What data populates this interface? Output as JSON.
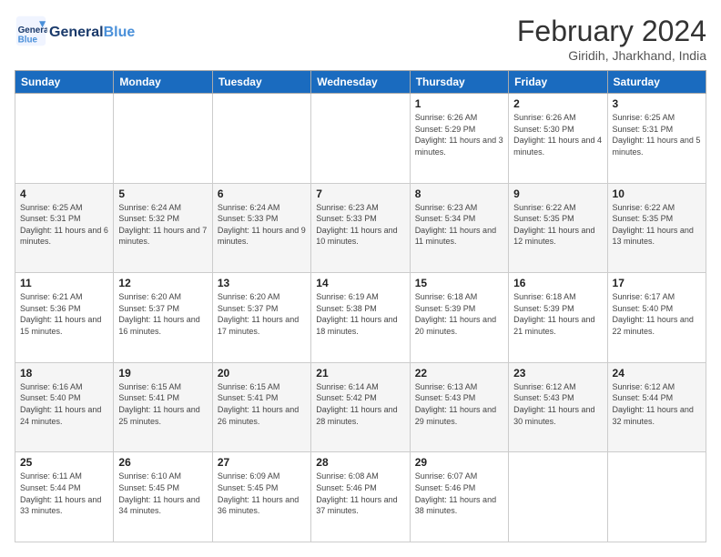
{
  "header": {
    "logo": {
      "general": "General",
      "blue": "Blue"
    },
    "title": "February 2024",
    "location": "Giridih, Jharkhand, India"
  },
  "weekdays": [
    "Sunday",
    "Monday",
    "Tuesday",
    "Wednesday",
    "Thursday",
    "Friday",
    "Saturday"
  ],
  "weeks": [
    [
      {
        "day": "",
        "info": ""
      },
      {
        "day": "",
        "info": ""
      },
      {
        "day": "",
        "info": ""
      },
      {
        "day": "",
        "info": ""
      },
      {
        "day": "1",
        "info": "Sunrise: 6:26 AM\nSunset: 5:29 PM\nDaylight: 11 hours and 3 minutes."
      },
      {
        "day": "2",
        "info": "Sunrise: 6:26 AM\nSunset: 5:30 PM\nDaylight: 11 hours and 4 minutes."
      },
      {
        "day": "3",
        "info": "Sunrise: 6:25 AM\nSunset: 5:31 PM\nDaylight: 11 hours and 5 minutes."
      }
    ],
    [
      {
        "day": "4",
        "info": "Sunrise: 6:25 AM\nSunset: 5:31 PM\nDaylight: 11 hours and 6 minutes."
      },
      {
        "day": "5",
        "info": "Sunrise: 6:24 AM\nSunset: 5:32 PM\nDaylight: 11 hours and 7 minutes."
      },
      {
        "day": "6",
        "info": "Sunrise: 6:24 AM\nSunset: 5:33 PM\nDaylight: 11 hours and 9 minutes."
      },
      {
        "day": "7",
        "info": "Sunrise: 6:23 AM\nSunset: 5:33 PM\nDaylight: 11 hours and 10 minutes."
      },
      {
        "day": "8",
        "info": "Sunrise: 6:23 AM\nSunset: 5:34 PM\nDaylight: 11 hours and 11 minutes."
      },
      {
        "day": "9",
        "info": "Sunrise: 6:22 AM\nSunset: 5:35 PM\nDaylight: 11 hours and 12 minutes."
      },
      {
        "day": "10",
        "info": "Sunrise: 6:22 AM\nSunset: 5:35 PM\nDaylight: 11 hours and 13 minutes."
      }
    ],
    [
      {
        "day": "11",
        "info": "Sunrise: 6:21 AM\nSunset: 5:36 PM\nDaylight: 11 hours and 15 minutes."
      },
      {
        "day": "12",
        "info": "Sunrise: 6:20 AM\nSunset: 5:37 PM\nDaylight: 11 hours and 16 minutes."
      },
      {
        "day": "13",
        "info": "Sunrise: 6:20 AM\nSunset: 5:37 PM\nDaylight: 11 hours and 17 minutes."
      },
      {
        "day": "14",
        "info": "Sunrise: 6:19 AM\nSunset: 5:38 PM\nDaylight: 11 hours and 18 minutes."
      },
      {
        "day": "15",
        "info": "Sunrise: 6:18 AM\nSunset: 5:39 PM\nDaylight: 11 hours and 20 minutes."
      },
      {
        "day": "16",
        "info": "Sunrise: 6:18 AM\nSunset: 5:39 PM\nDaylight: 11 hours and 21 minutes."
      },
      {
        "day": "17",
        "info": "Sunrise: 6:17 AM\nSunset: 5:40 PM\nDaylight: 11 hours and 22 minutes."
      }
    ],
    [
      {
        "day": "18",
        "info": "Sunrise: 6:16 AM\nSunset: 5:40 PM\nDaylight: 11 hours and 24 minutes."
      },
      {
        "day": "19",
        "info": "Sunrise: 6:15 AM\nSunset: 5:41 PM\nDaylight: 11 hours and 25 minutes."
      },
      {
        "day": "20",
        "info": "Sunrise: 6:15 AM\nSunset: 5:41 PM\nDaylight: 11 hours and 26 minutes."
      },
      {
        "day": "21",
        "info": "Sunrise: 6:14 AM\nSunset: 5:42 PM\nDaylight: 11 hours and 28 minutes."
      },
      {
        "day": "22",
        "info": "Sunrise: 6:13 AM\nSunset: 5:43 PM\nDaylight: 11 hours and 29 minutes."
      },
      {
        "day": "23",
        "info": "Sunrise: 6:12 AM\nSunset: 5:43 PM\nDaylight: 11 hours and 30 minutes."
      },
      {
        "day": "24",
        "info": "Sunrise: 6:12 AM\nSunset: 5:44 PM\nDaylight: 11 hours and 32 minutes."
      }
    ],
    [
      {
        "day": "25",
        "info": "Sunrise: 6:11 AM\nSunset: 5:44 PM\nDaylight: 11 hours and 33 minutes."
      },
      {
        "day": "26",
        "info": "Sunrise: 6:10 AM\nSunset: 5:45 PM\nDaylight: 11 hours and 34 minutes."
      },
      {
        "day": "27",
        "info": "Sunrise: 6:09 AM\nSunset: 5:45 PM\nDaylight: 11 hours and 36 minutes."
      },
      {
        "day": "28",
        "info": "Sunrise: 6:08 AM\nSunset: 5:46 PM\nDaylight: 11 hours and 37 minutes."
      },
      {
        "day": "29",
        "info": "Sunrise: 6:07 AM\nSunset: 5:46 PM\nDaylight: 11 hours and 38 minutes."
      },
      {
        "day": "",
        "info": ""
      },
      {
        "day": "",
        "info": ""
      }
    ]
  ]
}
